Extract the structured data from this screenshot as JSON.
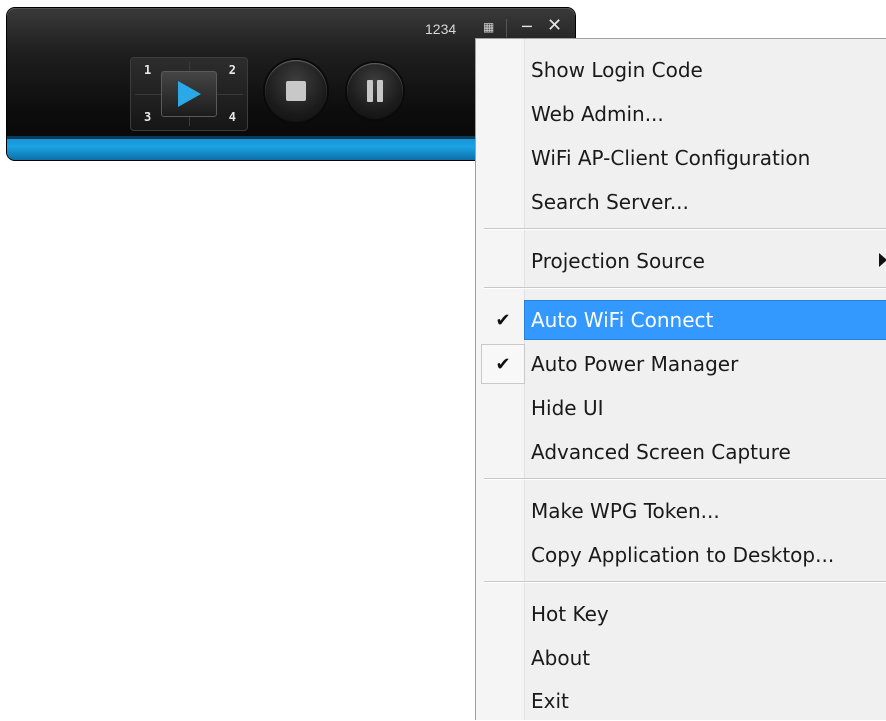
{
  "toolbar": {
    "login_code": "1234",
    "quad_labels": [
      "1",
      "2",
      "3",
      "4"
    ],
    "icons": {
      "layout": "layout-toggle-icon",
      "minimize": "minimize-icon",
      "close": "close-icon",
      "play": "play-icon",
      "stop": "stop-icon",
      "pause": "pause-icon"
    },
    "colors": {
      "accent": "#1ba3e3",
      "play_icon": "#2aa8e8"
    }
  },
  "menu": {
    "items": [
      {
        "label": "Show Login Code"
      },
      {
        "label": "Web Admin..."
      },
      {
        "label": "WiFi AP-Client Configuration"
      },
      {
        "label": "Search Server..."
      },
      {
        "label": "Projection Source",
        "submenu": true
      },
      {
        "label": "Auto WiFi Connect",
        "checked": true,
        "highlighted": true
      },
      {
        "label": "Auto Power Manager",
        "checked": true
      },
      {
        "label": "Hide UI"
      },
      {
        "label": "Advanced Screen Capture"
      },
      {
        "label": "Make WPG Token..."
      },
      {
        "label": "Copy Application to Desktop..."
      },
      {
        "label": "Hot Key"
      },
      {
        "label": "About"
      },
      {
        "label": "Exit"
      }
    ],
    "highlight_color": "#3399ff"
  }
}
